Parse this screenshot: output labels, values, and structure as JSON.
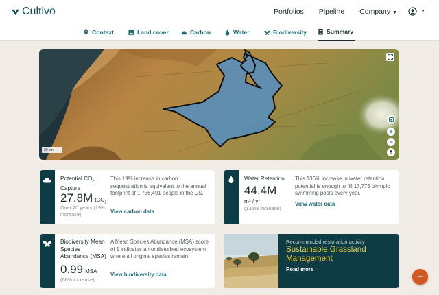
{
  "app": {
    "name": "Cultivo"
  },
  "topnav": {
    "portfolios": "Portfolios",
    "pipeline": "Pipeline",
    "company": "Company"
  },
  "tabs": [
    {
      "label": "Context",
      "icon": "map-pin-icon"
    },
    {
      "label": "Land cover",
      "icon": "image-icon"
    },
    {
      "label": "Carbon",
      "icon": "cloud-icon"
    },
    {
      "label": "Water",
      "icon": "water-drop-icon"
    },
    {
      "label": "Biodiversity",
      "icon": "butterfly-icon"
    },
    {
      "label": "Summary",
      "icon": "document-icon",
      "active": true
    }
  ],
  "map": {
    "scale_label": "20 km"
  },
  "carbon": {
    "title_a": "Potential CO",
    "title_sub": "2",
    "title_b": "Capture",
    "value": "27.8M",
    "unit": "tCO",
    "unit_sub": "2",
    "note": "Over 20 years (19% increase)",
    "desc": "This 19% increase in carbon sequestration is equivalent to the annual footprint of 1,736,491 people in the US.",
    "link": "View carbon data"
  },
  "water": {
    "title": "Water Retention",
    "value": "44.4M",
    "unit": "m³ / yr",
    "note": "(136% increase)",
    "desc": "This 136% increase in water retention potential is enough to fill 17,775 olympic swimming pools every year.",
    "link": "View water data"
  },
  "biodiversity": {
    "title": "Biodiversity Mean Species Abundance (MSA)",
    "value": "0.99",
    "unit": "MSA",
    "note": "(66% increase)",
    "desc": "A Mean Species Abundance (MSA) score of 1 indicates an undisturbed ecosystem where all original species remain.",
    "link": "View biodiversity data"
  },
  "recommendation": {
    "label": "Recommended restoration activity",
    "title": "Sustainable Grassland Management",
    "link": "Read more"
  },
  "fab": {
    "label": "+"
  },
  "colors": {
    "brand": "#0f5257",
    "accent": "#1e6d74",
    "card_strip": "#0d3c44",
    "highlight": "#e2cd4a",
    "fab": "#d4571e",
    "polygon": "#4f8fc9"
  }
}
